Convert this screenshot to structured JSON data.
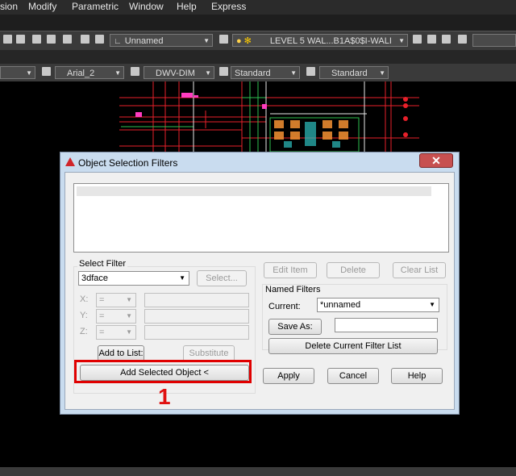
{
  "menu": {
    "items": [
      "sion",
      "Modify",
      "Parametric",
      "Window",
      "Help",
      "Express"
    ]
  },
  "toolbar1": {
    "named_view": "Unnamed",
    "layer": "LEVEL 5 WAL...B1A$0$I-WALI"
  },
  "toolbar2": {
    "font_combo": "Arial_2",
    "dimstyle_combo": "DWV-DIM",
    "tablestyle_combo": "Standard",
    "multileader_combo": "Standard"
  },
  "dialog": {
    "title": "Object Selection Filters",
    "close_glyph": "✕",
    "select_filter": {
      "heading": "Select Filter",
      "selected_type": "3dface",
      "select_button": "Select...",
      "x_label": "X:",
      "y_label": "Y:",
      "z_label": "Z:",
      "operator": "=",
      "add_to_list_button": "Add to List:",
      "substitute_button": "Substitute",
      "add_selected_object_button": "Add Selected Object <"
    },
    "list_buttons": {
      "edit_item": "Edit Item",
      "delete": "Delete",
      "clear_list": "Clear List"
    },
    "named_filters": {
      "heading": "Named Filters",
      "current_label": "Current:",
      "current_value": "*unnamed",
      "save_as_button": "Save As:",
      "save_as_value": "",
      "delete_current_button": "Delete Current Filter List"
    },
    "footer_buttons": {
      "apply": "Apply",
      "cancel": "Cancel",
      "help": "Help"
    }
  },
  "annotation": {
    "step_number": "1",
    "highlight_color": "#e00000"
  }
}
